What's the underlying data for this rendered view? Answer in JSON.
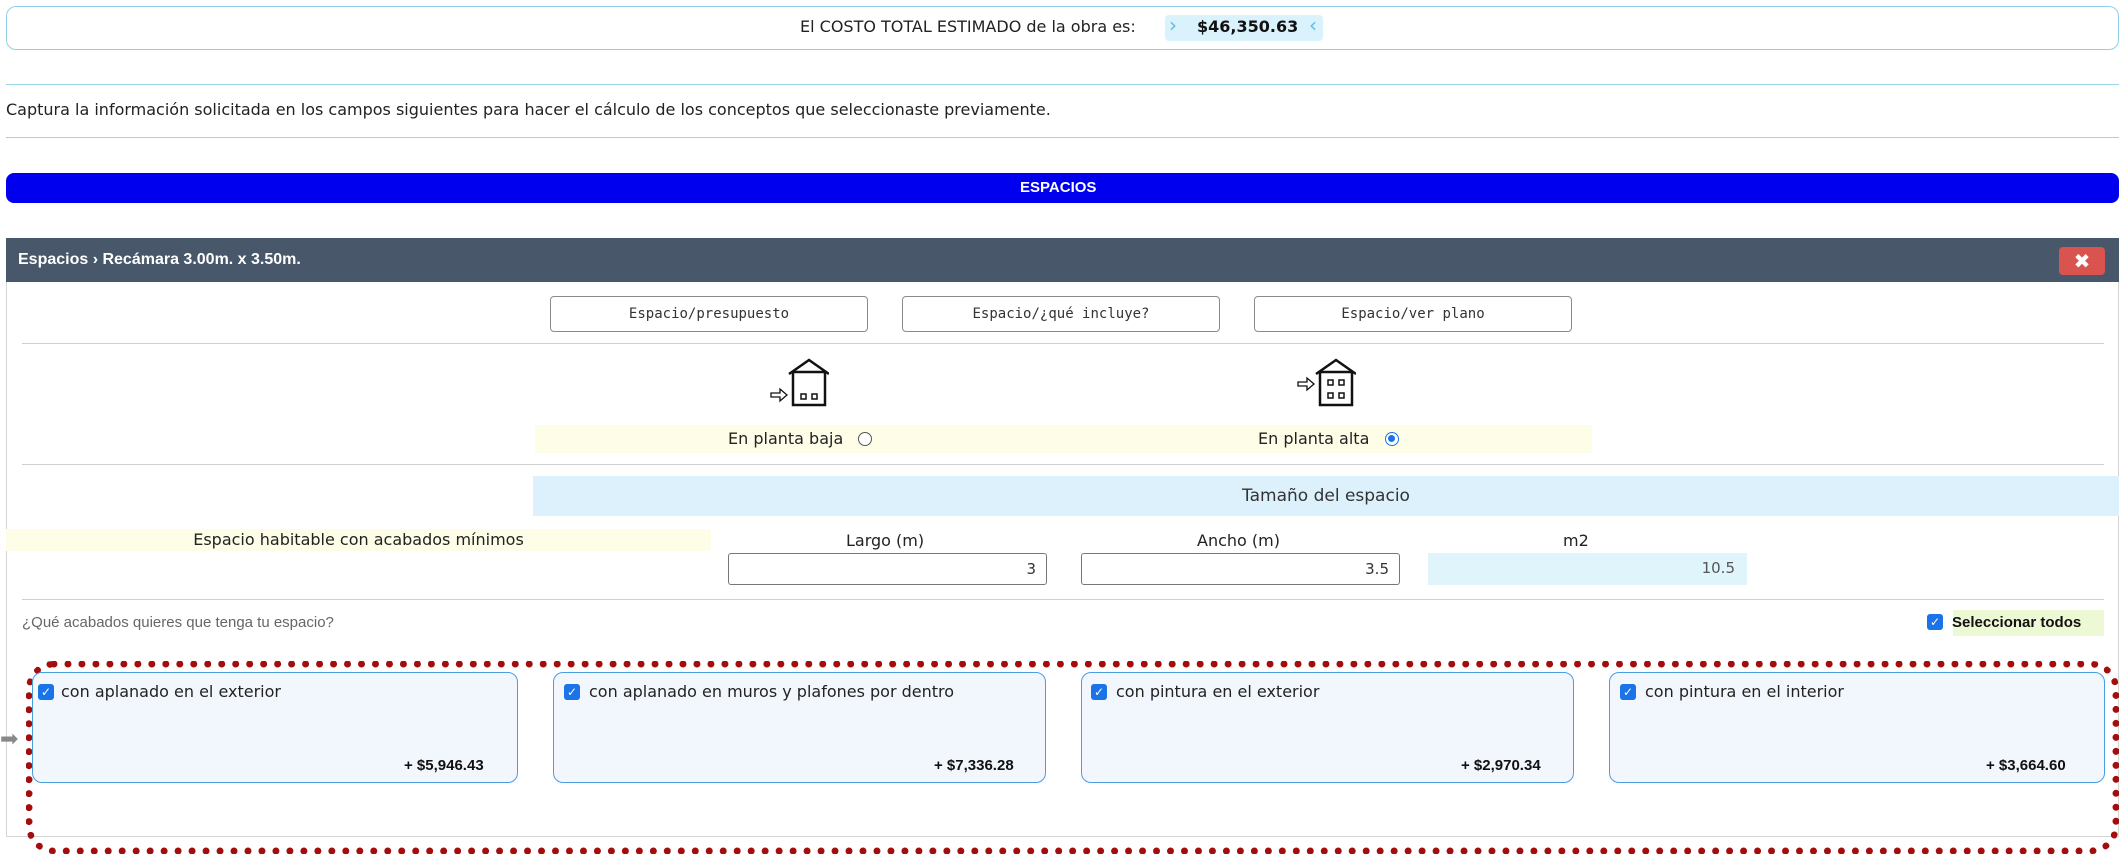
{
  "total": {
    "label": "El COSTO TOTAL ESTIMADO de la obra es:",
    "value": "$46,350.63"
  },
  "intro_text": "Captura la información solicitada en los campos siguientes para hacer el cálculo de los conceptos que seleccionaste previamente.",
  "section_title": "ESPACIOS",
  "panel": {
    "breadcrumb": "Espacios › Recámara 3.00m. x 3.50m.",
    "close_icon": "✖",
    "buttons": [
      "Espacio/presupuesto",
      "Espacio/¿qué incluye?",
      "Espacio/ver plano"
    ]
  },
  "floors": {
    "ground": {
      "label": "En planta baja",
      "selected": false,
      "icon": "house-ground-floor-icon"
    },
    "upper": {
      "label": "En planta alta",
      "selected": true,
      "icon": "house-upper-floor-icon"
    }
  },
  "size": {
    "title": "Tamaño del espacio",
    "habitable_label": "Espacio habitable con acabados mínimos",
    "largo_label": "Largo (m)",
    "ancho_label": "Ancho (m)",
    "m2_label": "m2",
    "largo_value": "3",
    "ancho_value": "3.5",
    "m2_value": "10.5"
  },
  "finishes": {
    "question": "¿Qué acabados quieres que tenga tu espacio?",
    "select_all_label": "Seleccionar todos",
    "select_all_checked": true,
    "items": [
      {
        "label": "con aplanado en el exterior",
        "price": "+  $5,946.43",
        "checked": true
      },
      {
        "label": "con aplanado en muros y plafones por dentro",
        "price": "+  $7,336.28",
        "checked": true
      },
      {
        "label": "con pintura en el exterior",
        "price": "+  $2,970.34",
        "checked": true
      },
      {
        "label": "con pintura en el interior",
        "price": "+  $3,664.60",
        "checked": true
      }
    ]
  },
  "colors": {
    "section_bar": "#0000ee",
    "panel_header": "#48576a",
    "close_button": "#d9534f",
    "checkbox": "#1a73e8",
    "highlight_frame": "#a30d0d"
  }
}
